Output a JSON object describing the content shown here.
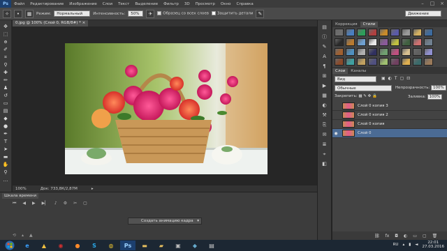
{
  "app": {
    "logo": "Ps"
  },
  "menu": [
    "Файл",
    "Редактирование",
    "Изображение",
    "Слои",
    "Текст",
    "Выделение",
    "Фильтр",
    "3D",
    "Просмотр",
    "Окно",
    "Справка"
  ],
  "options": {
    "mode_label": "Режим:",
    "mode_value": "Нормальный",
    "intensity_label": "Интенсивность:",
    "intensity_value": "50%",
    "sample_all_label": "Образец со всех слоев",
    "protect_label": "Защитить детали",
    "workspace": "Движение"
  },
  "document": {
    "tab": "0.jpg @ 100% (Слой 0, RGB/8#) *",
    "zoom": "100%",
    "doc_info": "Док: 733,8К/2,87М"
  },
  "timeline": {
    "tab": "Шкала времени",
    "create_button": "Создать анимацию кадра"
  },
  "panels": {
    "tabs_top": [
      "Коррекция",
      "Стили"
    ],
    "tabs_layers": [
      "Слои",
      "Каналы"
    ],
    "kind": "Вид",
    "blend": "Обычные",
    "opacity_label": "Непрозрачность:",
    "opacity_value": "100%",
    "lock_label": "Закрепить:",
    "fill_label": "Заливка:",
    "fill_value": "100%",
    "layers": [
      {
        "name": "Слой 0 копия 3",
        "selected": false
      },
      {
        "name": "Слой 0 копия 2",
        "selected": false
      },
      {
        "name": "Слой 0 копия",
        "selected": false
      },
      {
        "name": "Слой 0",
        "selected": true
      }
    ],
    "style_colors": [
      "#6e6e6e",
      "#4a7fc0",
      "#2e9e5a",
      "#b04040",
      "#c88a2a",
      "#5a5aa8",
      "#9a9a9a",
      "#d4b060",
      "#3d6b9e",
      "#2a2a2a",
      "#b87a30",
      "#6fa0d0",
      "#e8e8e8",
      "#8a5a9a",
      "#c0c040",
      "#406040",
      "#d07070",
      "#708090",
      "#a06030",
      "#5090c0",
      "#b0b0b0",
      "#303060",
      "#70a070",
      "#c05080",
      "#d8c090",
      "#606060",
      "#9090d0",
      "#8a4a2a",
      "#40a0a0",
      "#c0a060",
      "#505080",
      "#a0c070",
      "#704060",
      "#e0b050",
      "#3a6a6a",
      "#9a7a5a"
    ]
  },
  "taskbar": {
    "language": "RU",
    "time": "22:01",
    "date": "27.03.2016"
  }
}
